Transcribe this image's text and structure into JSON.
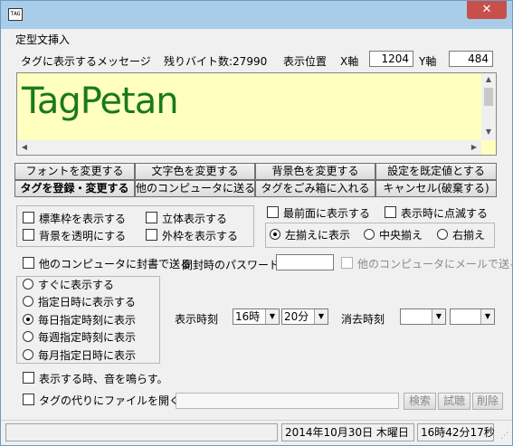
{
  "window": {
    "icon_text": "TAG",
    "close_symbol": "✕"
  },
  "caption": "定型文挿入",
  "header": {
    "message_label": "タグに表示するメッセージ",
    "remaining_label": "残りバイト数:",
    "remaining_value": "27990",
    "position_label": "表示位置",
    "x_label": "X軸",
    "x_value": "1204",
    "y_label": "Y軸",
    "y_value": "484"
  },
  "editor": {
    "text": "TagPetan",
    "bg": "#ffffc0",
    "text_color": "#1a7a1a"
  },
  "buttons": {
    "font": "フォントを変更する",
    "text_color": "文字色を変更する",
    "bg_color": "背景色を変更する",
    "default": "設定を既定値とする",
    "register": "タグを登録・変更する",
    "send": "他のコンピュータに送る",
    "trash": "タグをごみ箱に入れる",
    "cancel": "キャンセル(破棄する)"
  },
  "style_options": {
    "standard_frame": "標準枠を表示する",
    "solid": "立体表示する",
    "transparent_bg": "背景を透明にする",
    "outer_frame": "外枠を表示する"
  },
  "front_options": {
    "topmost": "最前面に表示する",
    "blink": "表示時に点滅する"
  },
  "align": {
    "left": "左揃えに表示",
    "center": "中央揃え",
    "right": "右揃え",
    "selected": "left"
  },
  "seal": {
    "seal_label": "他のコンピュータに封書で送る",
    "password_label": "開封時のパスワード",
    "password_value": "",
    "email_label": "他のコンピュータにメールで送る"
  },
  "schedule": {
    "immediate": "すぐに表示する",
    "specified_datetime": "指定日時に表示する",
    "daily": "毎日指定時刻に表示",
    "weekly": "毎週指定時刻に表示",
    "monthly": "毎月指定日時に表示",
    "selected": "daily"
  },
  "time": {
    "display_label": "表示時刻",
    "hour": "16時",
    "minute": "20分",
    "erase_label": "消去時刻",
    "erase_hour": "",
    "erase_minute": ""
  },
  "sound": {
    "label": "表示する時、音を鳴らす。"
  },
  "file": {
    "label": "タグの代りにファイルを開く。",
    "path": "",
    "search": "検索",
    "preview": "試聴",
    "delete": "削除"
  },
  "status": {
    "date": "2014年10月30日 木曜日",
    "time": "16時42分17秒"
  }
}
